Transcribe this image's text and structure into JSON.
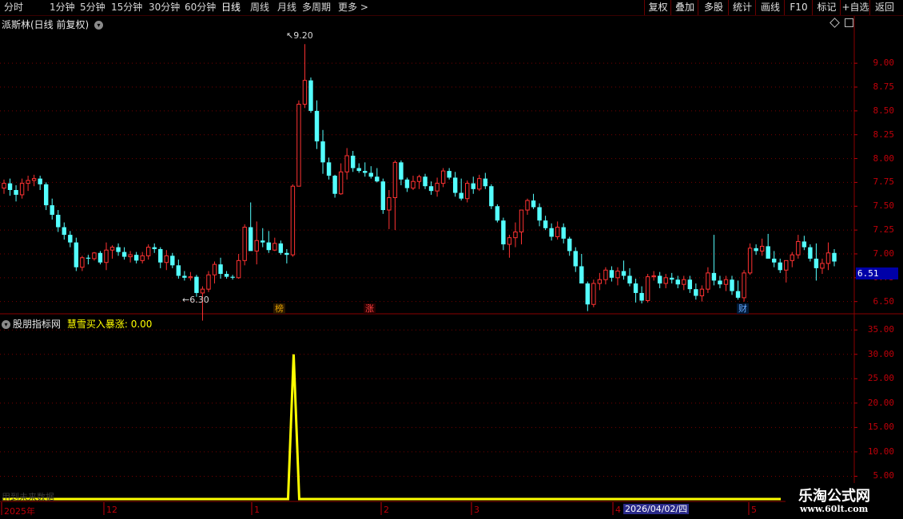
{
  "toolbar": {
    "periods": [
      "分时",
      "1分钟",
      "5分钟",
      "15分钟",
      "30分钟",
      "60分钟",
      "日线",
      "周线",
      "月线",
      "多周期",
      "更多 >"
    ],
    "active_period": "日线",
    "buttons": [
      "复权",
      "叠加",
      "多股",
      "统计",
      "画线",
      "F10",
      "标记",
      "+自选",
      "返回"
    ]
  },
  "main_panel": {
    "title": "派斯林(日线 前复权)",
    "current_price": "6.51",
    "high_label": "9.20",
    "low_label": "6.30",
    "markers": [
      {
        "text": "榜",
        "color": "#e0a000"
      },
      {
        "text": "涨",
        "color": "#e03030"
      },
      {
        "text": "财",
        "color": "#5aa0ff"
      }
    ]
  },
  "indicator_panel": {
    "name": "股朋指标网",
    "series_label": "慧雪买入暴涨: 0.00",
    "ghost_text": "用到未来数据"
  },
  "date_axis": {
    "labels": [
      "2025年",
      "12",
      "1",
      "2",
      "3",
      "4",
      "5"
    ],
    "selected": "2026/04/02/四"
  },
  "watermark": {
    "title": "乐淘公式网",
    "url": "www.60lt.com"
  },
  "colors": {
    "up": "#ff3232",
    "down": "#54ffff",
    "axis": "#c0000a",
    "indicator": "#ffff00"
  },
  "chart_data": [
    {
      "type": "candlestick",
      "title": "派斯林(日线 前复权)",
      "y_ticks": [
        "9.00",
        "8.75",
        "8.50",
        "8.25",
        "8.00",
        "7.75",
        "7.50",
        "7.25",
        "7.00",
        "6.75",
        "6.50"
      ],
      "ylim": [
        6.38,
        9.37
      ],
      "high": 9.2,
      "low": 6.3,
      "last": 6.51,
      "candles_ohlc": [
        [
          7.69,
          7.78,
          7.63,
          7.74
        ],
        [
          7.74,
          7.79,
          7.61,
          7.67
        ],
        [
          7.67,
          7.72,
          7.55,
          7.62
        ],
        [
          7.62,
          7.79,
          7.58,
          7.74
        ],
        [
          7.74,
          7.82,
          7.66,
          7.77
        ],
        [
          7.77,
          7.83,
          7.71,
          7.79
        ],
        [
          7.79,
          7.82,
          7.67,
          7.73
        ],
        [
          7.73,
          7.75,
          7.46,
          7.51
        ],
        [
          7.51,
          7.58,
          7.36,
          7.41
        ],
        [
          7.41,
          7.46,
          7.23,
          7.28
        ],
        [
          7.28,
          7.33,
          7.15,
          7.2
        ],
        [
          7.2,
          7.24,
          7.07,
          7.12
        ],
        [
          7.12,
          7.17,
          6.82,
          6.86
        ],
        [
          6.86,
          6.98,
          6.82,
          6.96
        ],
        [
          6.96,
          6.99,
          6.89,
          6.95
        ],
        [
          6.95,
          7.02,
          6.93,
          7.01
        ],
        [
          7.01,
          7.03,
          6.89,
          6.91
        ],
        [
          6.91,
          7.12,
          6.83,
          7.04
        ],
        [
          7.04,
          7.09,
          6.95,
          7.07
        ],
        [
          7.07,
          7.11,
          6.98,
          7.02
        ],
        [
          7.02,
          7.07,
          6.94,
          6.97
        ],
        [
          6.97,
          7.03,
          6.91,
          6.99
        ],
        [
          6.99,
          7.02,
          6.9,
          6.93
        ],
        [
          6.93,
          7.02,
          6.9,
          6.98
        ],
        [
          6.98,
          7.1,
          6.94,
          7.07
        ],
        [
          7.07,
          7.11,
          7.01,
          7.05
        ],
        [
          7.05,
          7.07,
          6.85,
          6.91
        ],
        [
          6.91,
          7.04,
          6.83,
          6.98
        ],
        [
          6.98,
          7.01,
          6.85,
          6.88
        ],
        [
          6.88,
          6.94,
          6.74,
          6.77
        ],
        [
          6.77,
          6.82,
          6.72,
          6.75
        ],
        [
          6.75,
          6.81,
          6.72,
          6.76
        ],
        [
          6.76,
          6.78,
          6.55,
          6.59
        ],
        [
          6.59,
          6.66,
          6.3,
          6.63
        ],
        [
          6.63,
          6.82,
          6.6,
          6.78
        ],
        [
          6.78,
          6.92,
          6.69,
          6.89
        ],
        [
          6.89,
          6.96,
          6.74,
          6.79
        ],
        [
          6.79,
          6.82,
          6.74,
          6.76
        ],
        [
          6.76,
          6.78,
          6.73,
          6.75
        ],
        [
          6.75,
          7.0,
          6.74,
          6.93
        ],
        [
          6.93,
          7.31,
          6.88,
          7.28
        ],
        [
          7.28,
          7.54,
          7.08,
          7.03
        ],
        [
          7.03,
          7.34,
          6.89,
          7.14
        ],
        [
          7.14,
          7.27,
          7.07,
          7.12
        ],
        [
          7.12,
          7.24,
          7.01,
          7.04
        ],
        [
          7.04,
          7.17,
          7.03,
          7.11
        ],
        [
          7.11,
          7.14,
          6.99,
          7.01
        ],
        [
          7.01,
          7.05,
          6.9,
          6.99
        ],
        [
          6.99,
          7.73,
          6.97,
          7.71
        ],
        [
          7.71,
          8.61,
          7.93,
          8.57
        ],
        [
          8.57,
          9.2,
          8.53,
          8.82
        ],
        [
          8.82,
          8.85,
          8.48,
          8.5
        ],
        [
          8.5,
          8.61,
          8.1,
          8.18
        ],
        [
          8.18,
          8.3,
          7.84,
          7.96
        ],
        [
          7.96,
          8.01,
          7.78,
          7.82
        ],
        [
          7.82,
          7.83,
          7.59,
          7.63
        ],
        [
          7.63,
          7.95,
          7.62,
          7.86
        ],
        [
          7.86,
          8.11,
          7.78,
          8.03
        ],
        [
          8.03,
          8.08,
          7.86,
          7.9
        ],
        [
          7.9,
          7.95,
          7.85,
          7.87
        ],
        [
          7.87,
          7.96,
          7.81,
          7.85
        ],
        [
          7.85,
          7.92,
          7.79,
          7.81
        ],
        [
          7.81,
          7.9,
          7.75,
          7.76
        ],
        [
          7.76,
          7.79,
          7.42,
          7.46
        ],
        [
          7.46,
          7.67,
          7.26,
          7.59
        ],
        [
          7.59,
          7.98,
          7.25,
          7.96
        ],
        [
          7.96,
          7.98,
          7.72,
          7.78
        ],
        [
          7.78,
          7.8,
          7.65,
          7.69
        ],
        [
          7.69,
          7.82,
          7.67,
          7.76
        ],
        [
          7.76,
          7.83,
          7.68,
          7.81
        ],
        [
          7.81,
          7.84,
          7.68,
          7.71
        ],
        [
          7.71,
          7.76,
          7.62,
          7.66
        ],
        [
          7.66,
          7.8,
          7.6,
          7.74
        ],
        [
          7.74,
          7.9,
          7.7,
          7.87
        ],
        [
          7.87,
          7.9,
          7.78,
          7.8
        ],
        [
          7.8,
          7.86,
          7.6,
          7.64
        ],
        [
          7.64,
          7.79,
          7.56,
          7.58
        ],
        [
          7.58,
          7.77,
          7.54,
          7.74
        ],
        [
          7.74,
          7.81,
          7.63,
          7.68
        ],
        [
          7.68,
          7.83,
          7.66,
          7.79
        ],
        [
          7.79,
          7.85,
          7.68,
          7.71
        ],
        [
          7.71,
          7.73,
          7.47,
          7.5
        ],
        [
          7.5,
          7.52,
          7.33,
          7.35
        ],
        [
          7.35,
          7.38,
          7.04,
          7.1
        ],
        [
          7.1,
          7.2,
          6.96,
          7.17
        ],
        [
          7.17,
          7.33,
          7.07,
          7.23
        ],
        [
          7.23,
          7.44,
          7.1,
          7.46
        ],
        [
          7.46,
          7.58,
          7.41,
          7.56
        ],
        [
          7.56,
          7.63,
          7.47,
          7.49
        ],
        [
          7.49,
          7.53,
          7.29,
          7.35
        ],
        [
          7.35,
          7.4,
          7.25,
          7.27
        ],
        [
          7.27,
          7.32,
          7.14,
          7.18
        ],
        [
          7.18,
          7.34,
          7.15,
          7.28
        ],
        [
          7.28,
          7.32,
          7.11,
          7.16
        ],
        [
          7.16,
          7.18,
          6.98,
          7.03
        ],
        [
          7.03,
          7.07,
          6.81,
          6.87
        ],
        [
          6.87,
          7.0,
          6.78,
          6.69
        ],
        [
          6.69,
          6.71,
          6.4,
          6.47
        ],
        [
          6.47,
          6.73,
          6.44,
          6.69
        ],
        [
          6.69,
          6.8,
          6.62,
          6.73
        ],
        [
          6.73,
          6.86,
          6.68,
          6.83
        ],
        [
          6.83,
          6.87,
          6.71,
          6.75
        ],
        [
          6.75,
          6.86,
          6.67,
          6.82
        ],
        [
          6.82,
          6.93,
          6.73,
          6.77
        ],
        [
          6.77,
          6.85,
          6.66,
          6.69
        ],
        [
          6.69,
          6.74,
          6.49,
          6.59
        ],
        [
          6.59,
          6.66,
          6.48,
          6.51
        ],
        [
          6.51,
          6.79,
          6.49,
          6.76
        ],
        [
          6.76,
          6.82,
          6.72,
          6.77
        ],
        [
          6.77,
          6.81,
          6.64,
          6.69
        ],
        [
          6.69,
          6.79,
          6.64,
          6.75
        ],
        [
          6.75,
          6.8,
          6.69,
          6.73
        ],
        [
          6.73,
          6.77,
          6.64,
          6.68
        ],
        [
          6.68,
          6.77,
          6.62,
          6.73
        ],
        [
          6.73,
          6.77,
          6.59,
          6.63
        ],
        [
          6.63,
          6.69,
          6.52,
          6.56
        ],
        [
          6.56,
          6.67,
          6.5,
          6.63
        ],
        [
          6.63,
          6.86,
          6.59,
          6.8
        ],
        [
          6.8,
          7.2,
          6.67,
          6.72
        ],
        [
          6.72,
          6.77,
          6.64,
          6.68
        ],
        [
          6.68,
          6.77,
          6.61,
          6.73
        ],
        [
          6.73,
          6.77,
          6.57,
          6.61
        ],
        [
          6.61,
          6.72,
          6.52,
          6.54
        ],
        [
          6.54,
          6.83,
          6.5,
          6.8
        ],
        [
          6.8,
          7.11,
          6.78,
          7.06
        ],
        [
          7.06,
          7.1,
          6.99,
          7.03
        ],
        [
          7.03,
          7.16,
          6.98,
          7.08
        ],
        [
          7.08,
          7.21,
          7.03,
          6.95
        ],
        [
          6.95,
          7.03,
          6.86,
          6.91
        ],
        [
          6.91,
          6.95,
          6.8,
          6.83
        ],
        [
          6.83,
          6.91,
          6.7,
          6.93
        ],
        [
          6.93,
          7.02,
          6.86,
          6.99
        ],
        [
          6.99,
          7.2,
          6.95,
          7.13
        ],
        [
          7.13,
          7.19,
          7.04,
          7.07
        ],
        [
          7.07,
          7.1,
          6.92,
          6.95
        ],
        [
          6.95,
          7.11,
          6.72,
          6.85
        ],
        [
          6.85,
          6.95,
          6.79,
          6.9
        ],
        [
          6.9,
          7.12,
          6.83,
          7.01
        ],
        [
          7.01,
          7.05,
          6.87,
          6.92
        ]
      ]
    },
    {
      "type": "line",
      "title": "慧雪买入暴涨",
      "y_ticks": [
        "35.00",
        "30.00",
        "25.00",
        "20.00",
        "15.00",
        "10.00",
        "5.00"
      ],
      "ylim": [
        0,
        37
      ],
      "series": [
        {
          "name": "慧雪买入暴涨",
          "spike_index": 50,
          "spike_value": 30.0,
          "baseline": 0.0,
          "last": 0.0
        }
      ]
    }
  ]
}
